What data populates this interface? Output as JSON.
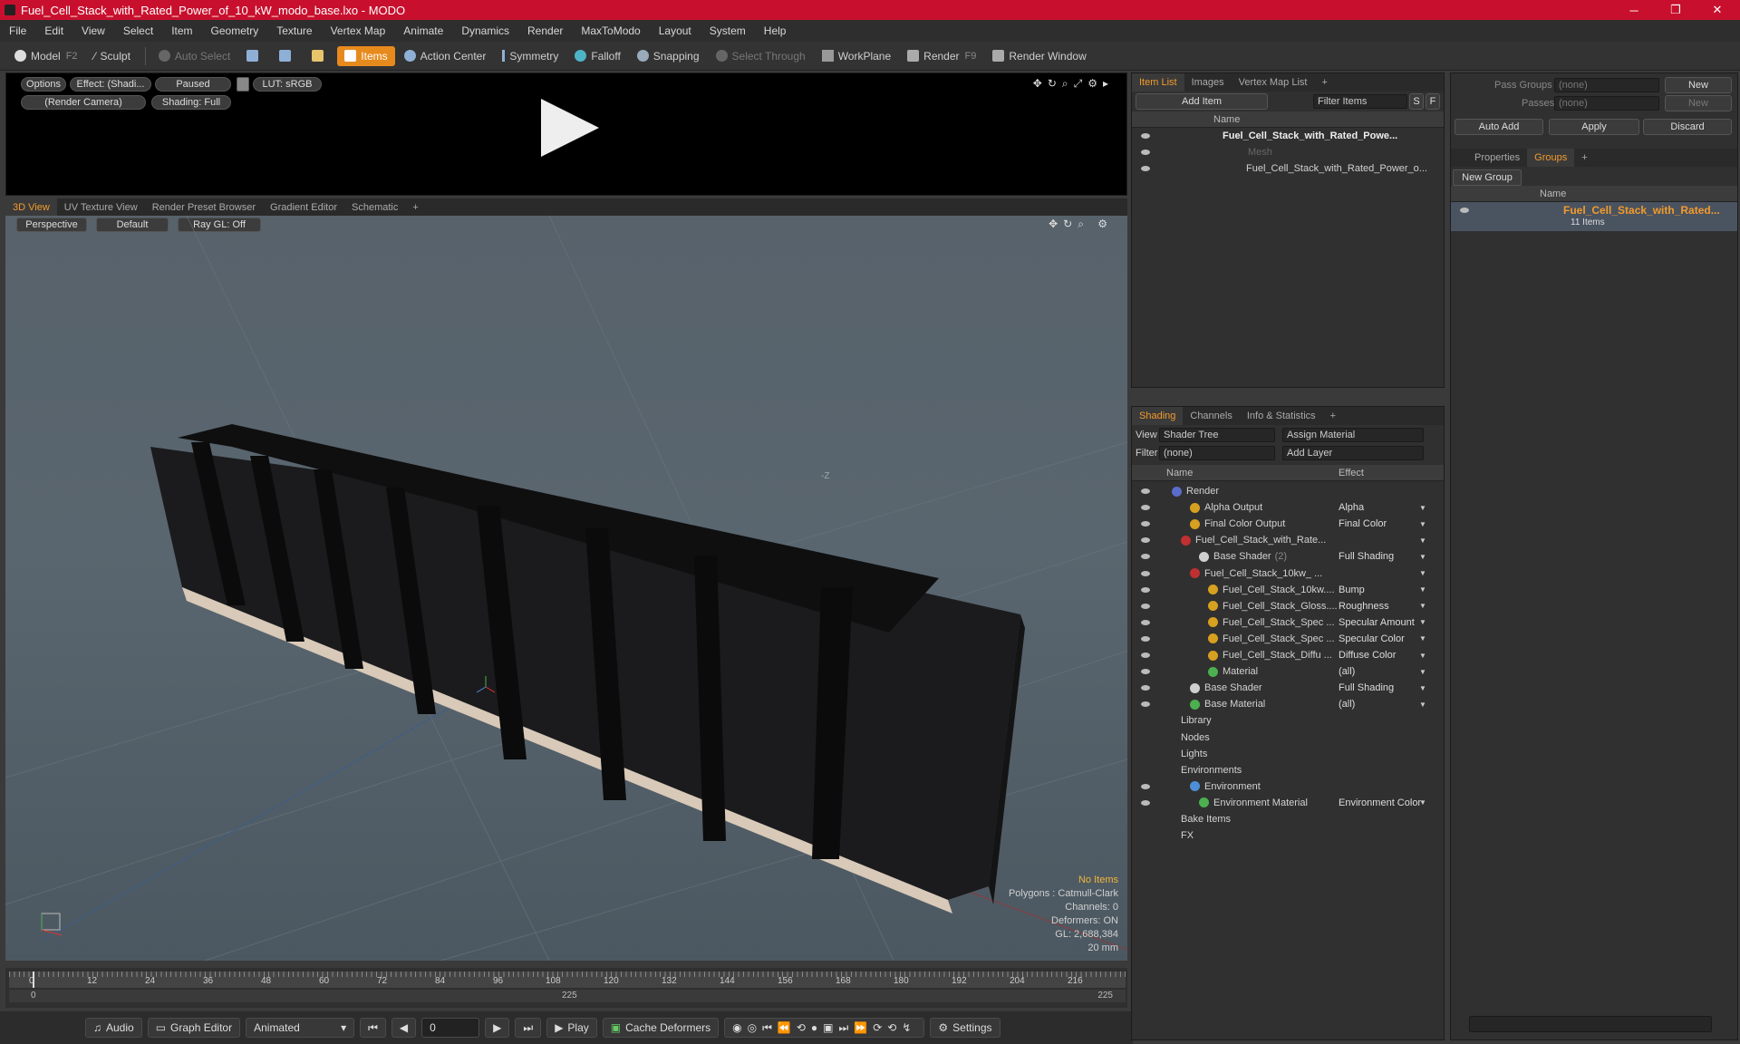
{
  "window": {
    "title": "Fuel_Cell_Stack_with_Rated_Power_of_10_kW_modo_base.lxo - MODO",
    "minimize": "─",
    "maximize": "❐",
    "close": "✕"
  },
  "menu": [
    "File",
    "Edit",
    "View",
    "Select",
    "Item",
    "Geometry",
    "Texture",
    "Vertex Map",
    "Animate",
    "Dynamics",
    "Render",
    "MaxToModo",
    "Layout",
    "System",
    "Help"
  ],
  "toolbar": {
    "model": "Model",
    "model_key": "F2",
    "sculpt": "Sculpt",
    "auto_select": "Auto Select",
    "items": "Items",
    "action_center": "Action Center",
    "symmetry": "Symmetry",
    "falloff": "Falloff",
    "snapping": "Snapping",
    "select_through": "Select Through",
    "workplane": "WorkPlane",
    "render": "Render",
    "render_key": "F9",
    "render_window": "Render Window"
  },
  "render_view": {
    "options": "Options",
    "effect": "Effect: (Shadi...",
    "paused": "Paused",
    "lut": "LUT: sRGB",
    "camera": "(Render Camera)",
    "shading": "Shading: Full"
  },
  "view_tabs": [
    "3D View",
    "UV Texture View",
    "Render Preset Browser",
    "Gradient Editor",
    "Schematic",
    "+"
  ],
  "viewport": {
    "perspective": "Perspective",
    "default": "Default",
    "raygl": "Ray GL: Off",
    "axis_label": "-Z",
    "info": {
      "no_items": "No Items",
      "polygons": "Polygons : Catmull-Clark",
      "channels": "Channels: 0",
      "deformers": "Deformers: ON",
      "gl": "GL: 2,688,384",
      "unit": "20 mm"
    }
  },
  "timeline": {
    "ticks": [
      "0",
      "12",
      "24",
      "36",
      "48",
      "60",
      "72",
      "84",
      "96",
      "108",
      "120",
      "132",
      "144",
      "156",
      "168",
      "180",
      "192",
      "204",
      "216"
    ],
    "start": "0",
    "mid": "225",
    "end": "225"
  },
  "bottom": {
    "audio": "Audio",
    "graph_editor": "Graph Editor",
    "animated": "Animated",
    "frame": "0",
    "play": "Play",
    "cache": "Cache Deformers",
    "settings": "Settings"
  },
  "item_list": {
    "tabs": [
      "Item List",
      "Images",
      "Vertex Map List",
      "+"
    ],
    "add_item": "Add Item",
    "filter_items": "Filter Items",
    "s": "S",
    "f": "F",
    "col_name": "Name",
    "items": [
      {
        "label": "Fuel_Cell_Stack_with_Rated_Powe...",
        "bold": true
      },
      {
        "label": "Mesh",
        "dim": true
      },
      {
        "label": "Fuel_Cell_Stack_with_Rated_Power_o..."
      }
    ]
  },
  "shading": {
    "tabs": [
      "Shading",
      "Channels",
      "Info & Statistics",
      "+"
    ],
    "view_label": "View",
    "view_value": "Shader Tree",
    "assign": "Assign Material",
    "filter_label": "Filter",
    "filter_value": "(none)",
    "add_layer": "Add Layer",
    "col_name": "Name",
    "col_effect": "Effect",
    "rows": [
      {
        "name": "Render",
        "effect": "",
        "indent": 0,
        "color": "#5b6cc9"
      },
      {
        "name": "Alpha Output",
        "effect": "Alpha",
        "indent": 2,
        "color": "#d6a020"
      },
      {
        "name": "Final Color Output",
        "effect": "Final Color",
        "indent": 2,
        "color": "#d6a020"
      },
      {
        "name": "Fuel_Cell_Stack_with_Rate...",
        "effect": "",
        "indent": 1,
        "color": "#c03030"
      },
      {
        "name": "Base Shader",
        "extra": "(2)",
        "effect": "Full Shading",
        "indent": 3,
        "color": "#cfcfcf"
      },
      {
        "name": "Fuel_Cell_Stack_10kw_ ...",
        "effect": "",
        "indent": 2,
        "color": "#c03030"
      },
      {
        "name": "Fuel_Cell_Stack_10kw....",
        "effect": "Bump",
        "indent": 4,
        "color": "#d6a020"
      },
      {
        "name": "Fuel_Cell_Stack_Gloss....",
        "effect": "Roughness",
        "indent": 4,
        "color": "#d6a020"
      },
      {
        "name": "Fuel_Cell_Stack_Spec ...",
        "effect": "Specular Amount",
        "indent": 4,
        "color": "#d6a020"
      },
      {
        "name": "Fuel_Cell_Stack_Spec ...",
        "effect": "Specular Color",
        "indent": 4,
        "color": "#d6a020"
      },
      {
        "name": "Fuel_Cell_Stack_Diffu ...",
        "effect": "Diffuse Color",
        "indent": 4,
        "color": "#d6a020"
      },
      {
        "name": "Material",
        "effect": "(all)",
        "indent": 4,
        "color": "#4caf50"
      },
      {
        "name": "Base Shader",
        "effect": "Full Shading",
        "indent": 2,
        "color": "#cfcfcf"
      },
      {
        "name": "Base Material",
        "effect": "(all)",
        "indent": 2,
        "color": "#4caf50"
      },
      {
        "name": "Library",
        "effect": "",
        "indent": 1,
        "color": ""
      },
      {
        "name": "Nodes",
        "effect": "",
        "indent": 1,
        "color": ""
      },
      {
        "name": "Lights",
        "effect": "",
        "indent": 1,
        "color": ""
      },
      {
        "name": "Environments",
        "effect": "",
        "indent": 1,
        "color": ""
      },
      {
        "name": "Environment",
        "effect": "",
        "indent": 2,
        "color": "#4d8fd6"
      },
      {
        "name": "Environment Material",
        "effect": "Environment Color",
        "indent": 3,
        "color": "#4caf50"
      },
      {
        "name": "Bake Items",
        "effect": "",
        "indent": 1,
        "color": ""
      },
      {
        "name": "FX",
        "effect": "",
        "indent": 1,
        "color": ""
      }
    ]
  },
  "right": {
    "pass_groups": "Pass Groups",
    "passes": "Passes",
    "none": "(none)",
    "new": "New",
    "auto_add": "Auto Add",
    "apply": "Apply",
    "discard": "Discard",
    "tabs": [
      "Properties",
      "Groups",
      "+"
    ],
    "new_group": "New Group",
    "col_name": "Name",
    "group_name": "Fuel_Cell_Stack_with_Rated...",
    "group_count": "11 Items"
  },
  "colors": {
    "accent": "#f29b2c",
    "title": "#c8102e"
  }
}
